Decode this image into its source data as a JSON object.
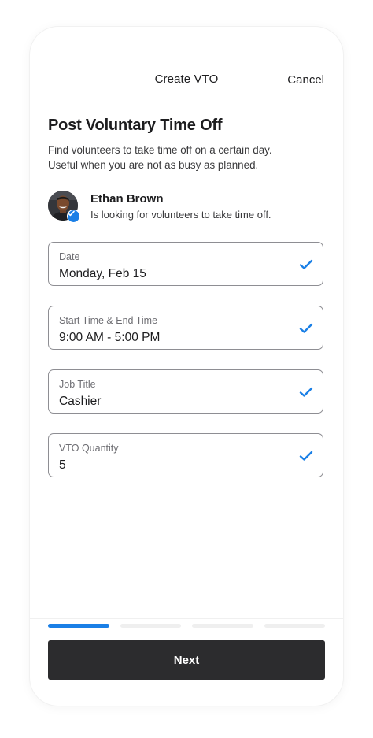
{
  "header": {
    "title": "Create VTO",
    "cancel_label": "Cancel"
  },
  "page": {
    "heading": "Post Voluntary Time Off",
    "description_line1": "Find volunteers to take time off on a certain day.",
    "description_line2": "Useful when you are not as busy as planned."
  },
  "user": {
    "name": "Ethan Brown",
    "subtitle": "Is looking for volunteers to take time off.",
    "verified": true
  },
  "fields": [
    {
      "label": "Date",
      "value": "Monday, Feb 15",
      "complete": true
    },
    {
      "label": "Start Time & End Time",
      "value": "9:00 AM - 5:00 PM",
      "complete": true
    },
    {
      "label": "Job Title",
      "value": "Cashier",
      "complete": true
    },
    {
      "label": "VTO Quantity",
      "value": "5",
      "complete": true
    }
  ],
  "progress": {
    "current_step": 1,
    "total_steps": 4
  },
  "footer": {
    "next_label": "Next"
  },
  "colors": {
    "accent": "#1a7fe6",
    "button_bg": "#2c2c2e",
    "field_border": "#8e8e93"
  }
}
